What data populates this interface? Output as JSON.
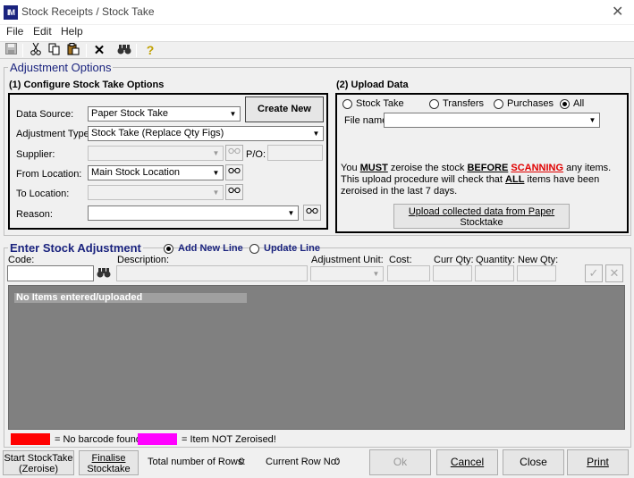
{
  "window": {
    "title": "Stock Receipts / Stock Take",
    "app_icon_text": "IM",
    "close_glyph": "✕"
  },
  "menu": [
    "File",
    "Edit",
    "Help"
  ],
  "toolbar": {
    "icons": [
      "save-icon",
      "cut-icon",
      "copy-icon",
      "paste-icon",
      "delete-icon",
      "find-icon",
      "help-icon"
    ]
  },
  "adjustment": {
    "group_title": "Adjustment Options",
    "configure": {
      "heading": "(1) Configure Stock Take Options",
      "create_new_label": "Create New",
      "data_source_label": "Data Source:",
      "data_source_value": "Paper Stock Take",
      "adjustment_type_label": "Adjustment Type:",
      "adjustment_type_value": "Stock Take (Replace Qty Figs)",
      "supplier_label": "Supplier:",
      "supplier_value": "",
      "po_label": "P/O:",
      "from_location_label": "From Location:",
      "from_location_value": "Main Stock Location",
      "to_location_label": "To  Location:",
      "to_location_value": "",
      "reason_label": "Reason:",
      "reason_value": ""
    },
    "upload": {
      "heading": "(2) Upload Data",
      "radio_stock_take": "Stock Take",
      "radio_transfers": "Transfers",
      "radio_purchases": "Purchases",
      "radio_all": "All",
      "selected": "All",
      "file_name_label": "File name:",
      "file_name_value": "",
      "notice_you": "You ",
      "notice_must": "MUST",
      "notice_zeroise": " zeroise the stock ",
      "notice_before": "BEFORE",
      "notice_scanning": "SCANNING",
      "notice_any": " any items.",
      "notice_line2_a": "This upload procedure will check that ",
      "notice_all": "ALL",
      "notice_line2_b": " items have been",
      "notice_line3": "zeroised in the last    7 days.",
      "upload_button_line1": "Upload collected data from Paper",
      "upload_button_line2": "Stocktake"
    }
  },
  "entry": {
    "group_title": "Enter Stock Adjustment",
    "add_new_line": "Add New Line",
    "update_line": "Update Line",
    "selected": "Add New Line",
    "code_label": "Code:",
    "description_label": "Description:",
    "adjustment_unit_label": "Adjustment Unit:",
    "cost_label": "Cost:",
    "curr_qty_label": "Curr Qty:",
    "quantity_label": "Quantity:",
    "new_qty_label": "New Qty:"
  },
  "grid": {
    "empty_message": "No Items entered/uploaded"
  },
  "legend": {
    "no_barcode_color": "#ff0000",
    "no_barcode_text": "= No barcode found.",
    "not_zeroised_color": "#ff00ff",
    "not_zeroised_text": "= Item NOT Zeroised!"
  },
  "footer": {
    "start_stocktake_line1": "Start StockTake",
    "start_stocktake_line2": "(Zeroise)",
    "finalise_line1": "Finalise",
    "finalise_line2": "Stocktake",
    "total_rows_label": "Total number of Rows:",
    "total_rows_value": "0",
    "current_row_label": "Current Row No:",
    "current_row_value": "0",
    "ok_label": "Ok",
    "cancel_label": "Cancel",
    "close_label": "Close",
    "print_label": "Print"
  }
}
